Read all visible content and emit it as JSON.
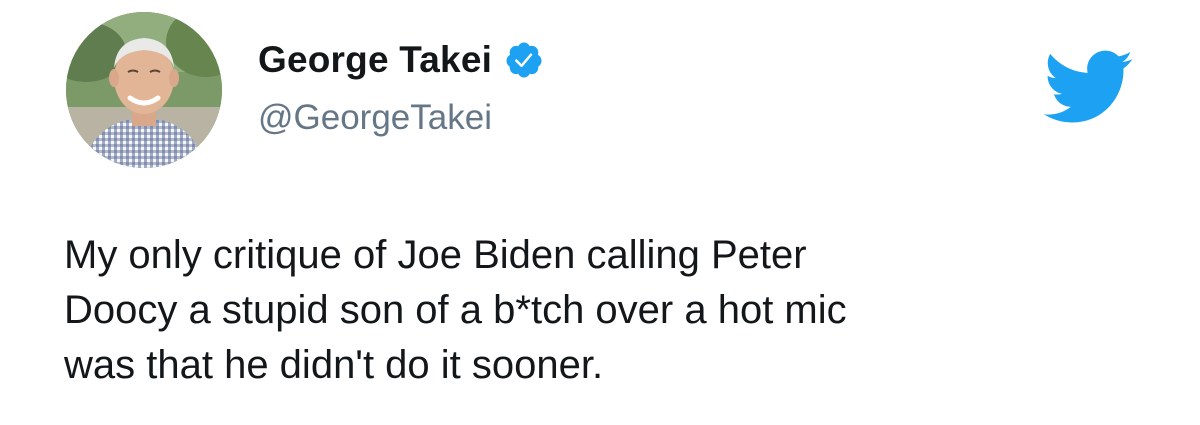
{
  "tweet": {
    "author": {
      "display_name": "George Takei",
      "handle": "@GeorgeTakei",
      "verified": true,
      "avatar_icon": "profile-photo"
    },
    "text": "My only critique of Joe Biden calling Peter\nDoocy a stupid son of a b*tch over a hot mic\nwas that he didn't do it sooner."
  },
  "brand": {
    "logo_icon": "twitter-bird-icon",
    "accent_color": "#1da1f2",
    "verified_color": "#1da1f2",
    "handle_color": "#657786",
    "text_color": "#14171a"
  }
}
